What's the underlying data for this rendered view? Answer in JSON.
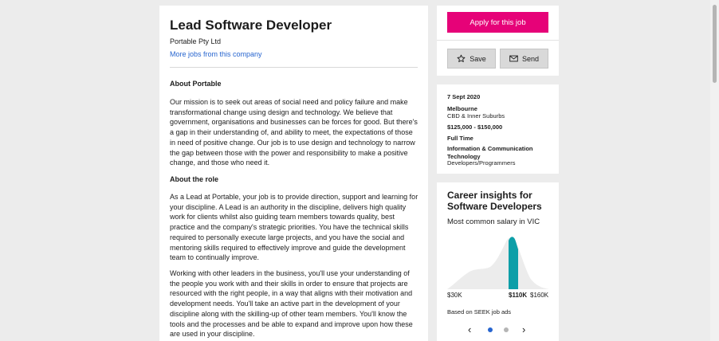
{
  "job": {
    "title": "Lead Software Developer",
    "company": "Portable Pty Ltd",
    "more_jobs_link": "More jobs from this company"
  },
  "description": {
    "heading_about": "About Portable",
    "about_text": "Our mission is to seek out areas of social need and policy failure and make transformational change using design and technology. We believe that government, organisations and businesses can be forces for good. But there's a gap in their understanding of, and ability to meet, the expectations of those in need of positive change. Our job is to use design and technology to narrow the gap between those with the power and responsibility to make a positive change, and those who need it.",
    "heading_role": "About the role",
    "role_text_1": "As a Lead at Portable, your job is to provide direction, support and learning for your discipline. A Lead is an authority in the discipline, delivers high quality work for clients whilst also guiding team members towards quality, best practice and the company's strategic priorities. You have the technical skills required to personally execute large projects, and you have the social and mentoring skills required to effectively improve and guide the development team to continually improve.",
    "role_text_2": "Working with other leaders in the business, you'll use your understanding of the people you work with and their skills in order to ensure that projects are resourced with the right people, in a way that aligns with their motivation and development needs. You'll take an active part in the development of your discipline along with the skilling-up of other team members. You'll know the tools and the processes and be able to expand and improve upon how these are used in your discipline."
  },
  "actions": {
    "apply_label": "Apply for this job",
    "save_label": "Save",
    "send_label": "Send"
  },
  "details": {
    "date": "7 Sept 2020",
    "location": "Melbourne",
    "area": "CBD & Inner Suburbs",
    "salary": "$125,000 - $150,000",
    "work_type": "Full Time",
    "classification": "Information & Communication Technology",
    "sub_classification": "Developers/Programmers"
  },
  "insights": {
    "title": "Career insights for Software Developers",
    "subtitle": "Most common salary in VIC",
    "min_label": "$30K",
    "common_label": "$110K",
    "max_label": "$160K",
    "basis": "Based on SEEK job ads",
    "carousel": {
      "total": 2,
      "active_index": 0
    }
  },
  "colors": {
    "brand": "#e60278",
    "link": "#2765cf",
    "highlight": "#0d9fa8",
    "distribution": "#ececec"
  }
}
